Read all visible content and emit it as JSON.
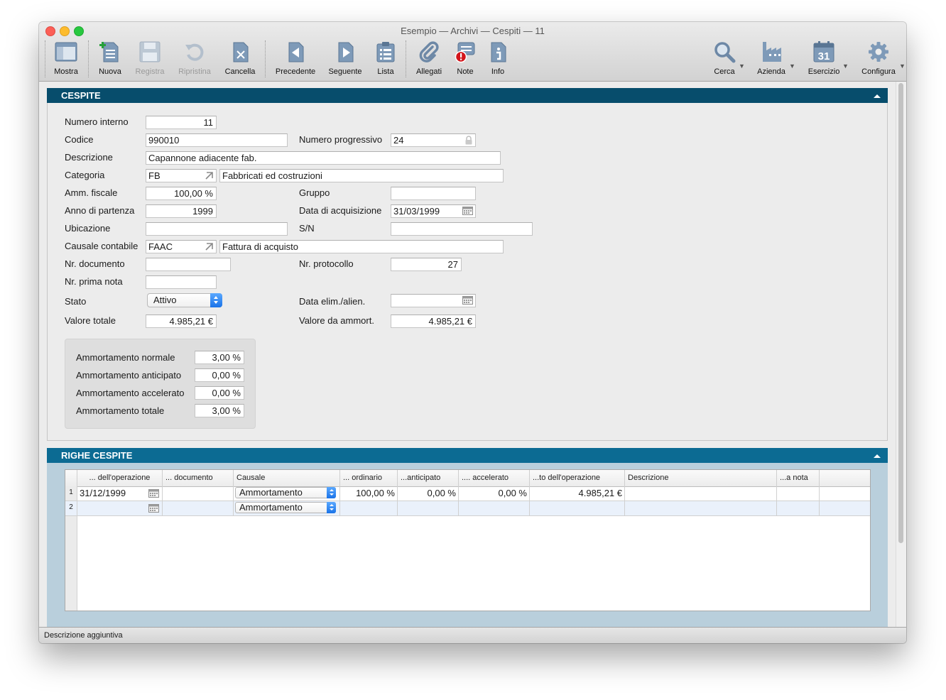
{
  "window": {
    "title": "Esempio — Archivi — Cespiti — 11"
  },
  "toolbar": {
    "mostra": "Mostra",
    "nuova": "Nuova",
    "registra": "Registra",
    "ripristina": "Ripristina",
    "cancella": "Cancella",
    "precedente": "Precedente",
    "seguente": "Seguente",
    "lista": "Lista",
    "allegati": "Allegati",
    "note": "Note",
    "info": "Info",
    "cerca": "Cerca",
    "azienda": "Azienda",
    "esercizio": "Esercizio",
    "esercizio_day": "31",
    "configura": "Configura"
  },
  "cespite": {
    "header": "CESPITE",
    "numero_interno_label": "Numero interno",
    "numero_interno": "11",
    "codice_label": "Codice",
    "codice": "990010",
    "numero_progressivo_label": "Numero progressivo",
    "numero_progressivo": "24",
    "descrizione_label": "Descrizione",
    "descrizione": "Capannone adiacente fab.",
    "categoria_label": "Categoria",
    "categoria_code": "FB",
    "categoria_desc": "Fabbricati ed costruzioni",
    "amm_fiscale_label": "Amm. fiscale",
    "amm_fiscale": "100,00 %",
    "gruppo_label": "Gruppo",
    "gruppo": "",
    "anno_partenza_label": "Anno di partenza",
    "anno_partenza": "1999",
    "data_acquisizione_label": "Data di acquisizione",
    "data_acquisizione": "31/03/1999",
    "ubicazione_label": "Ubicazione",
    "ubicazione": "",
    "sn_label": "S/N",
    "sn": "",
    "causale_label": "Causale contabile",
    "causale_code": "FAAC",
    "causale_desc": "Fattura di acquisto",
    "nr_documento_label": "Nr. documento",
    "nr_documento": "",
    "nr_protocollo_label": "Nr. protocollo",
    "nr_protocollo": "27",
    "nr_prima_nota_label": "Nr. prima nota",
    "nr_prima_nota": "",
    "stato_label": "Stato",
    "stato": "Attivo",
    "data_elim_label": "Data elim./alien.",
    "data_elim": "",
    "valore_totale_label": "Valore totale",
    "valore_totale": "4.985,21 €",
    "valore_ammort_label": "Valore da ammort.",
    "valore_ammort": "4.985,21 €"
  },
  "ammortamento": {
    "normale_label": "Ammortamento normale",
    "normale": "3,00 %",
    "anticipato_label": "Ammortamento anticipato",
    "anticipato": "0,00 %",
    "accelerato_label": "Ammortamento accelerato",
    "accelerato": "0,00 %",
    "totale_label": "Ammortamento totale",
    "totale": "3,00 %"
  },
  "righe": {
    "header": "RIGHE CESPITE",
    "columns": [
      "... dell'operazione",
      "... documento",
      "Causale",
      "... ordinario",
      "...anticipato",
      ".... accelerato",
      "...to dell'operazione",
      "Descrizione",
      "...a nota"
    ],
    "rows": [
      {
        "num": "1",
        "data": "31/12/1999",
        "documento": "",
        "causale": "Ammortamento",
        "ordinario": "100,00 %",
        "anticipato": "0,00 %",
        "accelerato": "0,00 %",
        "importo": "4.985,21 €",
        "descrizione": "",
        "nota": ""
      },
      {
        "num": "2",
        "data": "",
        "documento": "",
        "causale": "Ammortamento",
        "ordinario": "",
        "anticipato": "",
        "accelerato": "",
        "importo": "",
        "descrizione": "",
        "nota": ""
      }
    ]
  },
  "status": {
    "text": "Descrizione aggiuntiva"
  },
  "icons": {
    "mostra": "layout-icon",
    "nuova": "new-document-icon",
    "registra": "floppy-disk-icon",
    "ripristina": "revert-icon",
    "cancella": "delete-document-icon",
    "precedente": "previous-document-icon",
    "seguente": "next-document-icon",
    "lista": "clipboard-list-icon",
    "allegati": "paperclip-icon",
    "note": "notes-badge-icon",
    "info": "info-document-icon",
    "cerca": "magnifier-icon",
    "azienda": "factory-icon",
    "esercizio": "calendar-icon",
    "configura": "gear-icon"
  }
}
